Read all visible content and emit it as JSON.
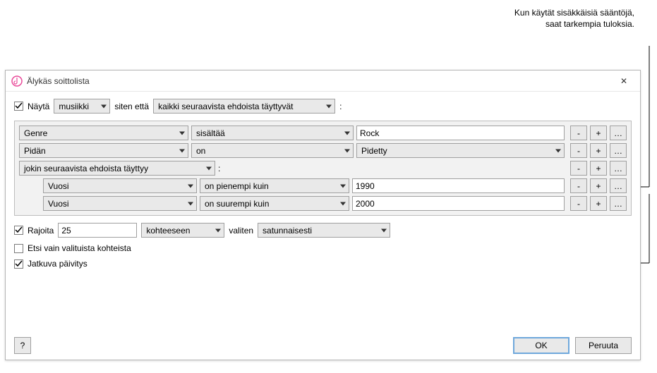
{
  "annotation": {
    "line1": "Kun käytät sisäkkäisiä sääntöjä,",
    "line2": "saat tarkempia tuloksia."
  },
  "titlebar": {
    "title": "Älykäs soittolista",
    "close_glyph": "✕"
  },
  "match": {
    "show_label": "Näytä",
    "media_type": "musiikki",
    "such_that": "siten että",
    "condition": "kaikki seuraavista ehdoista täyttyvät",
    "colon": ":"
  },
  "rules": [
    {
      "indent": 0,
      "field": "Genre",
      "op": "sisältää",
      "value_type": "text",
      "value": "Rock",
      "minus": "-",
      "plus": "+",
      "more": "…"
    },
    {
      "indent": 0,
      "field": "Pidän",
      "op": "on",
      "value_type": "select",
      "value": "Pidetty",
      "minus": "-",
      "plus": "+",
      "more": "…"
    },
    {
      "indent": 0,
      "nest_header": true,
      "nest_condition": "jokin seuraavista ehdoista täyttyy",
      "colon": ":",
      "minus": "-",
      "plus": "+",
      "more": "…"
    },
    {
      "indent": 1,
      "field": "Vuosi",
      "op": "on pienempi kuin",
      "value_type": "text",
      "value": "1990",
      "minus": "-",
      "plus": "+",
      "more": "…"
    },
    {
      "indent": 1,
      "field": "Vuosi",
      "op": "on suurempi kuin",
      "value_type": "text",
      "value": "2000",
      "minus": "-",
      "plus": "+",
      "more": "…"
    }
  ],
  "limit": {
    "checked": true,
    "label": "Rajoita",
    "count": "25",
    "unit": "kohteeseen",
    "selecting_label": "valiten",
    "method": "satunnaisesti"
  },
  "options": {
    "only_selected": {
      "checked": false,
      "label": "Etsi vain valituista kohteista"
    },
    "live_update": {
      "checked": true,
      "label": "Jatkuva päivitys"
    }
  },
  "footer": {
    "help": "?",
    "ok": "OK",
    "cancel": "Peruuta"
  }
}
